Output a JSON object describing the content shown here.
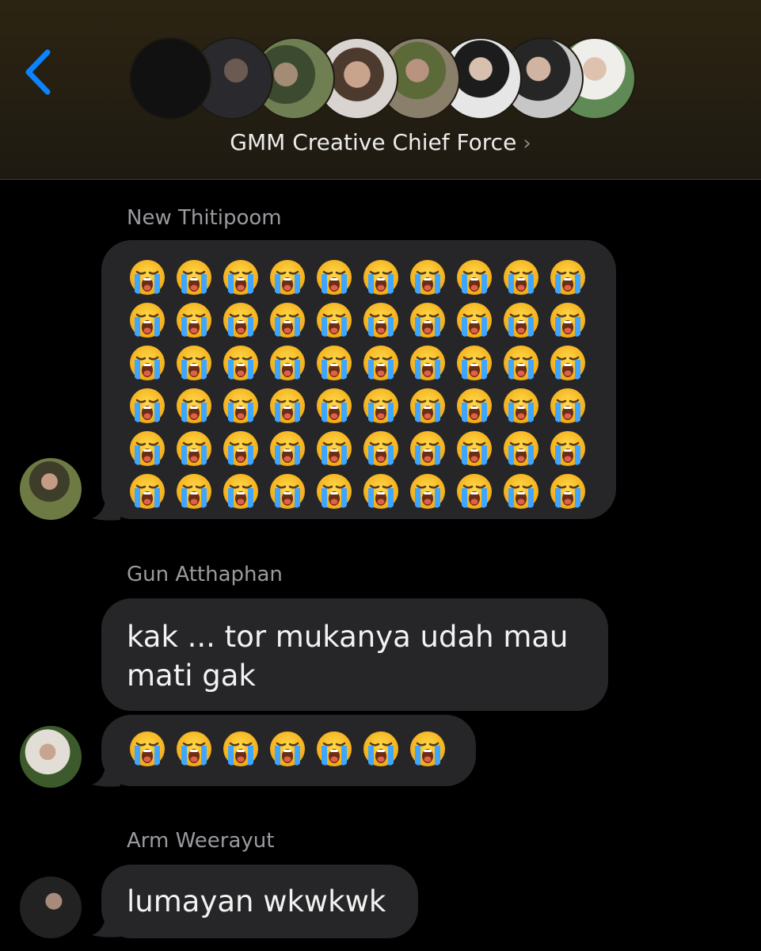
{
  "header": {
    "title": "GMM Creative Chief Force",
    "back_icon": "chevron-left-icon",
    "accent": "#0a84ff"
  },
  "messages": [
    {
      "sender": "New Thitipoom",
      "type": "emoji",
      "emoji": "😭",
      "count": 60
    },
    {
      "sender": "Gun Atthaphan",
      "type": "text",
      "text": "kak ... tor mukanya udah mau mati gak"
    },
    {
      "sender": "Gun Atthaphan",
      "type": "emoji",
      "emoji": "😭",
      "count": 7
    },
    {
      "sender": "Arm Weerayut",
      "type": "text",
      "text": "lumayan wkwkwk"
    }
  ],
  "colors": {
    "bubble": "#262628",
    "sender_name": "#9a9a9f",
    "text": "#f2f2f2"
  }
}
